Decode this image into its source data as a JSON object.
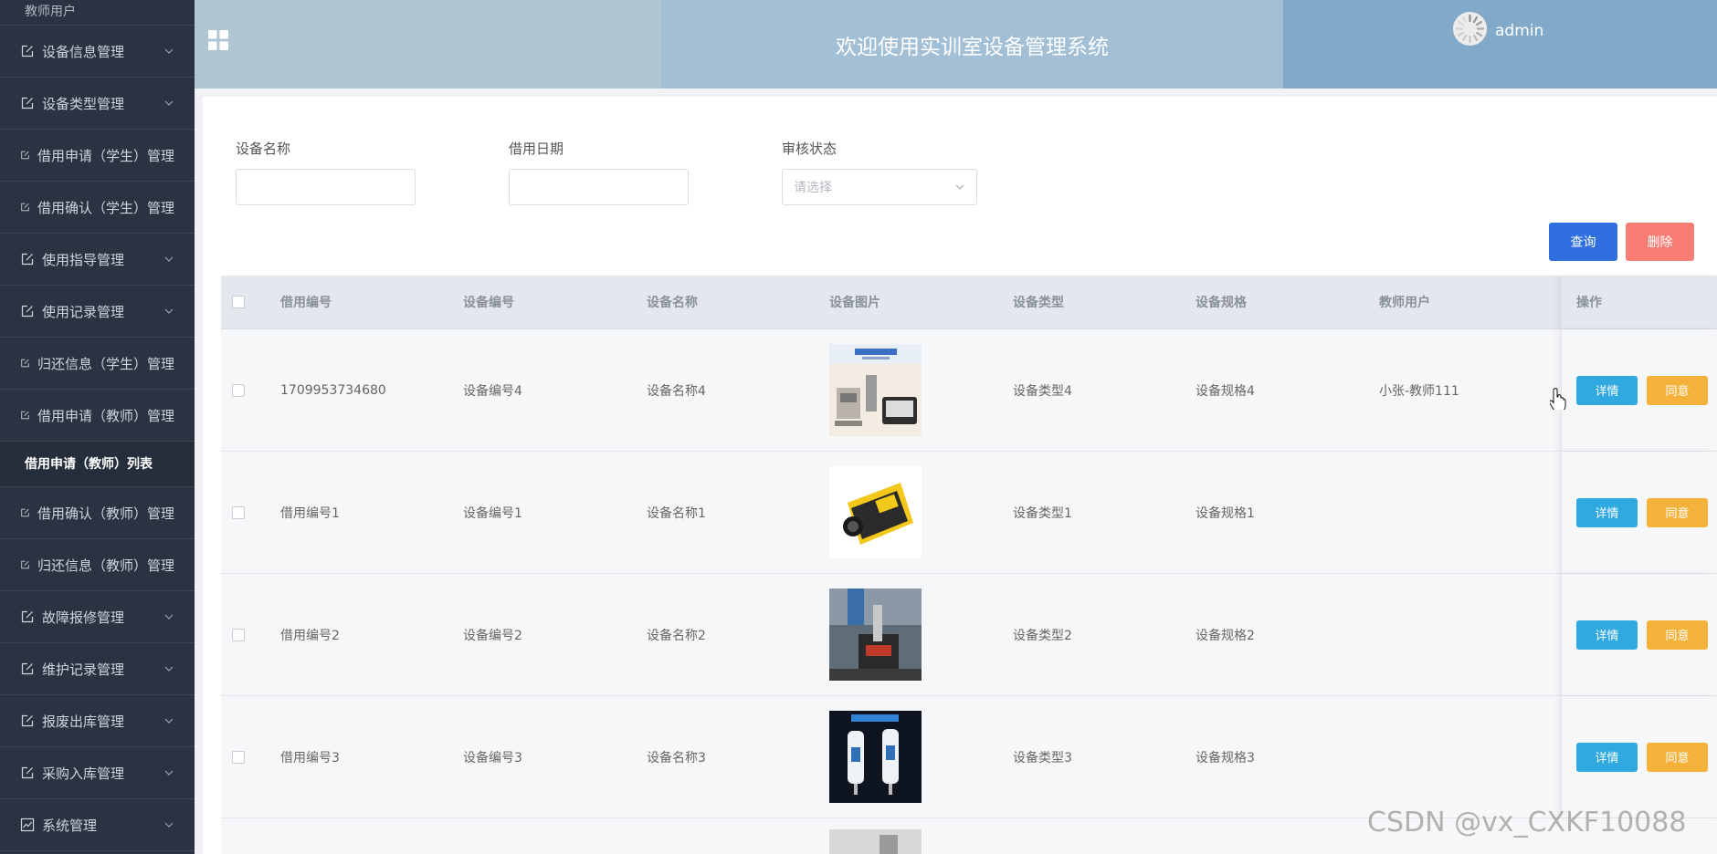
{
  "sidebar": {
    "user_label": "教师用户",
    "items_top": [
      {
        "label": "设备信息管理",
        "has_chevron": true
      },
      {
        "label": "设备类型管理",
        "has_chevron": true
      },
      {
        "label": "借用申请（学生）管理",
        "has_chevron": false
      },
      {
        "label": "借用确认（学生）管理",
        "has_chevron": false
      },
      {
        "label": "使用指导管理",
        "has_chevron": true
      },
      {
        "label": "使用记录管理",
        "has_chevron": true
      },
      {
        "label": "归还信息（学生）管理",
        "has_chevron": false
      },
      {
        "label": "借用申请（教师）管理",
        "has_chevron": false
      }
    ],
    "active_sub": "借用申请（教师）列表",
    "items_bottom": [
      {
        "label": "借用确认（教师）管理",
        "has_chevron": false
      },
      {
        "label": "归还信息（教师）管理",
        "has_chevron": false
      },
      {
        "label": "故障报修管理",
        "has_chevron": true
      },
      {
        "label": "维护记录管理",
        "has_chevron": true
      },
      {
        "label": "报废出库管理",
        "has_chevron": true
      },
      {
        "label": "采购入库管理",
        "has_chevron": true
      },
      {
        "label": "系统管理",
        "has_chevron": true
      }
    ]
  },
  "header": {
    "title": "欢迎使用实训室设备管理系统",
    "username": "admin"
  },
  "filters": {
    "name_label": "设备名称",
    "date_label": "借用日期",
    "status_label": "审核状态",
    "status_placeholder": "请选择",
    "name_value": "",
    "date_value": ""
  },
  "actions": {
    "query": "查询",
    "delete": "删除"
  },
  "table": {
    "headers": {
      "borrow_no": "借用编号",
      "equip_no": "设备编号",
      "equip_name": "设备名称",
      "equip_img": "设备图片",
      "equip_type": "设备类型",
      "equip_spec": "设备规格",
      "teacher": "教师用户",
      "ops": "操作"
    },
    "rows": [
      {
        "borrow_no": "1709953734680",
        "equip_no": "设备编号4",
        "equip_name": "设备名称4",
        "equip_type": "设备类型4",
        "equip_spec": "设备规格4",
        "teacher": "小张-教师111",
        "img": "lab-bench"
      },
      {
        "borrow_no": "借用编号1",
        "equip_no": "设备编号1",
        "equip_name": "设备名称1",
        "equip_type": "设备类型1",
        "equip_spec": "设备规格1",
        "teacher": "",
        "img": "yellow-device"
      },
      {
        "borrow_no": "借用编号2",
        "equip_no": "设备编号2",
        "equip_name": "设备名称2",
        "equip_type": "设备类型2",
        "equip_spec": "设备规格2",
        "teacher": "",
        "img": "microscope"
      },
      {
        "borrow_no": "借用编号3",
        "equip_no": "设备编号3",
        "equip_name": "设备名称3",
        "equip_type": "设备类型3",
        "equip_spec": "设备规格3",
        "teacher": "",
        "img": "probe-pens"
      }
    ],
    "op_detail": "详情",
    "op_agree": "同意"
  },
  "watermark": "CSDN @vx_CXKF10088",
  "colors": {
    "sidebar_bg": "#2b3343",
    "query_btn": "#2f6fe0",
    "delete_btn": "#f77d74",
    "detail_btn": "#2fa9e0",
    "agree_btn": "#f4b23a"
  }
}
